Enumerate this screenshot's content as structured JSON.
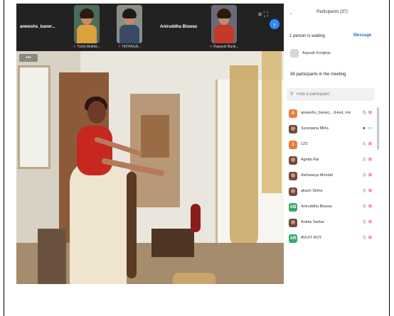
{
  "strip": {
    "tiles": [
      {
        "name": "anweshs_baner...",
        "label": ""
      },
      {
        "name": "",
        "label": "Tuhin Mukhe..."
      },
      {
        "name": "",
        "label": "TATHAGA..."
      },
      {
        "name": "Aniruddha Biswas",
        "label": ""
      },
      {
        "name": "",
        "label": "Rupashi Bank..."
      }
    ],
    "grid_icon": "≡",
    "fullscreen_icon": "⛶",
    "next_icon": "›"
  },
  "panel": {
    "collapse_icon": "⌄",
    "title": "Participants (37)",
    "waiting_text": "1 person is waiting",
    "message_label": "Message",
    "waiting_person": "Aayush Konjinar",
    "in_meeting_text": "36 participants in the meeting",
    "search_placeholder": "Find a participant",
    "participants": [
      {
        "initial": "A",
        "color": "#e8803a",
        "name": "anweshs_banerj... (Host, me)",
        "mic": "on",
        "cam": "off"
      },
      {
        "initial": "",
        "color": "#6d4c3c",
        "name": "Suranjana Mitra",
        "mic": "on",
        "cam": "on"
      },
      {
        "initial": "1",
        "color": "#e8803a",
        "name": "123",
        "mic": "off",
        "cam": "off"
      },
      {
        "initial": "",
        "color": "#6d4c3c",
        "name": "Agnita Rai",
        "mic": "off",
        "cam": "off"
      },
      {
        "initial": "",
        "color": "#6d4c3c",
        "name": "Aishwarya Mondal",
        "mic": "off",
        "cam": "off"
      },
      {
        "initial": "",
        "color": "#6d4c3c",
        "name": "akash Sinha",
        "mic": "off",
        "cam": "off"
      },
      {
        "initial": "AB",
        "color": "#3aa76d",
        "name": "Aniruddha Biswas",
        "mic": "off",
        "cam": "off"
      },
      {
        "initial": "",
        "color": "#6d4c3c",
        "name": "Ankita Sarkar",
        "mic": "off",
        "cam": "off"
      },
      {
        "initial": "AR",
        "color": "#3aa76d",
        "name": "AVIJIT ROY",
        "mic": "off",
        "cam": "off"
      }
    ]
  },
  "colors": {
    "accent": "#2d8cff",
    "muted_red": "#e0403a",
    "message_blue": "#2d6fd6"
  }
}
